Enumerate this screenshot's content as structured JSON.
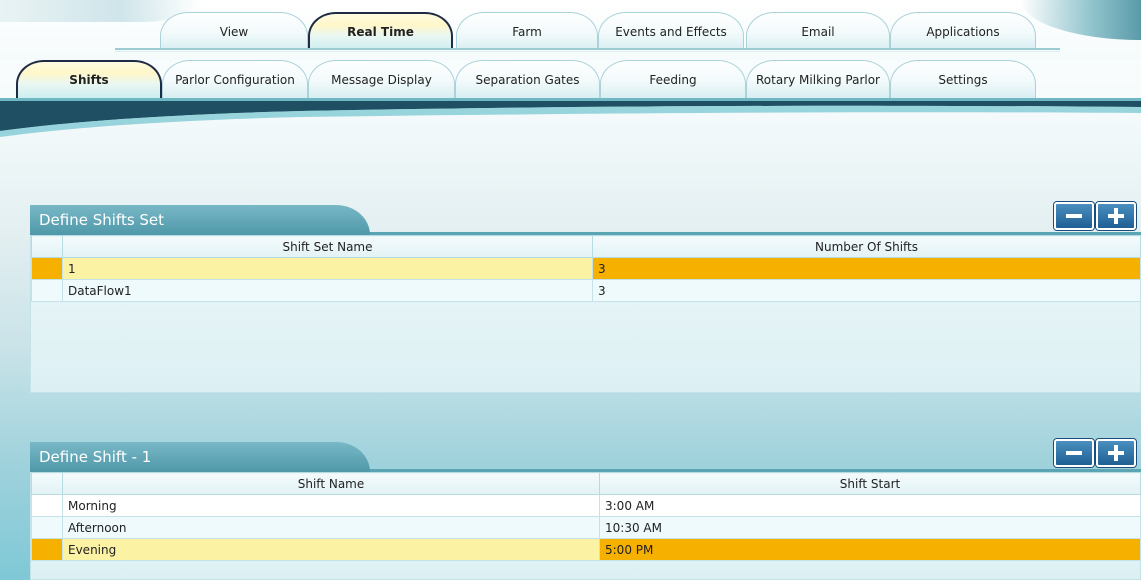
{
  "top_tabs": [
    {
      "label": "View",
      "active": false
    },
    {
      "label": "Real Time",
      "active": true
    },
    {
      "label": "Farm",
      "active": false
    },
    {
      "label": "Events and Effects",
      "active": false
    },
    {
      "label": "Email",
      "active": false
    },
    {
      "label": "Applications",
      "active": false
    }
  ],
  "sub_tabs": [
    {
      "label": "Shifts",
      "active": true
    },
    {
      "label": "Parlor Configuration",
      "active": false
    },
    {
      "label": "Message Display",
      "active": false
    },
    {
      "label": "Separation Gates",
      "active": false
    },
    {
      "label": "Feeding",
      "active": false
    },
    {
      "label": "Rotary Milking Parlor",
      "active": false
    },
    {
      "label": "Settings",
      "active": false
    }
  ],
  "shift_sets": {
    "title": "Define Shifts Set",
    "remove_icon": "minus-icon",
    "add_icon": "plus-icon",
    "columns": [
      "Shift Set Name",
      "Number Of Shifts"
    ],
    "rows": [
      {
        "name": "1",
        "count": "3",
        "selected": true
      },
      {
        "name": "DataFlow1",
        "count": "3",
        "selected": false
      }
    ]
  },
  "shifts": {
    "title": "Define Shift - 1",
    "remove_icon": "minus-icon",
    "add_icon": "plus-icon",
    "columns": [
      "Shift Name",
      "Shift Start"
    ],
    "rows": [
      {
        "name": "Morning",
        "start": "3:00 AM",
        "selected": false
      },
      {
        "name": "Afternoon",
        "start": "10:30 AM",
        "selected": false
      },
      {
        "name": "Evening",
        "start": "5:00 PM",
        "selected": true
      }
    ]
  },
  "colors": {
    "selected_row": "#f6b100",
    "selected_cell": "#fcf2a4",
    "section_header": "#4f98a9",
    "button": "#1f5f94"
  }
}
